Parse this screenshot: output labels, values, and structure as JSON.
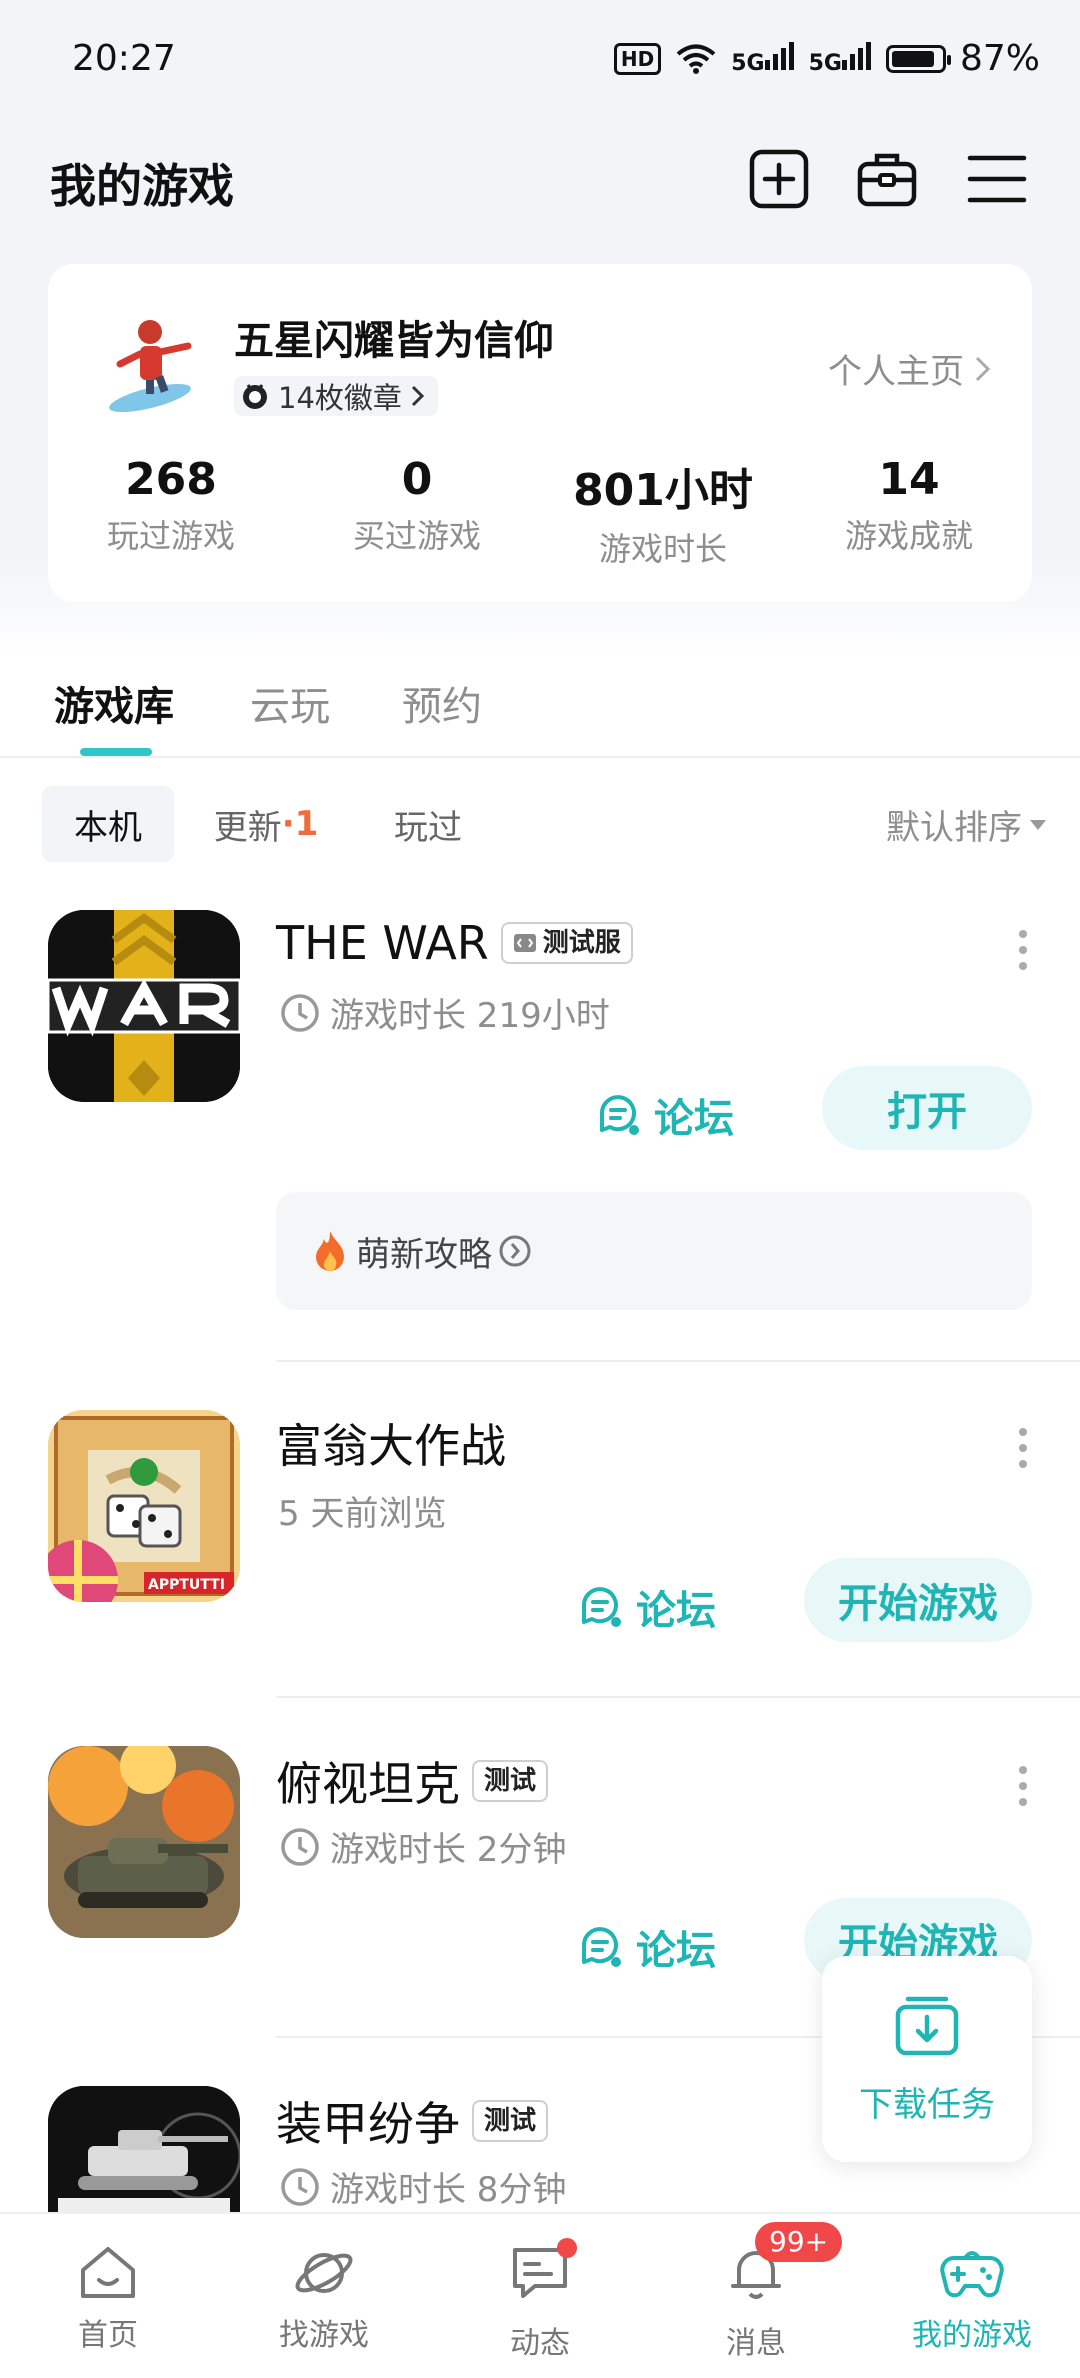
{
  "status_bar": {
    "time": "20:27",
    "hd": "HD",
    "net1": "5G",
    "net2": "5G",
    "battery": "87%",
    "battery_level": 0.87
  },
  "header": {
    "title": "我的游戏",
    "icons": [
      "add-square-icon",
      "toolbox-icon",
      "menu-icon"
    ]
  },
  "profile": {
    "username": "五星闪耀皆为信仰",
    "badges": "14枚徽章",
    "homepage": "个人主页",
    "stats": [
      {
        "value": "268",
        "label": "玩过游戏"
      },
      {
        "value": "0",
        "label": "买过游戏"
      },
      {
        "value": "801小时",
        "label": "游戏时长"
      },
      {
        "value": "14",
        "label": "游戏成就"
      }
    ]
  },
  "tabs": [
    "游戏库",
    "云玩",
    "预约"
  ],
  "filters": {
    "local": "本机",
    "update": "更新",
    "update_sep": "·",
    "update_count": "1",
    "played": "玩过",
    "sort": "默认排序"
  },
  "games": [
    {
      "name": "THE WAR",
      "tag": "测试服",
      "sub": "游戏时长 219小时",
      "forum": "论坛",
      "action": "打开",
      "guide": "萌新攻略"
    },
    {
      "name": "富翁大作战",
      "sub": "5 天前浏览",
      "forum": "论坛",
      "action": "开始游戏"
    },
    {
      "name": "俯视坦克",
      "tag": "测试",
      "sub": "游戏时长 2分钟",
      "forum": "论坛",
      "action": "开始游戏"
    },
    {
      "name": "装甲纷争",
      "tag": "测试",
      "sub": "游戏时长 8分钟"
    }
  ],
  "float": {
    "label": "下载任务"
  },
  "bottom_nav": [
    {
      "label": "首页"
    },
    {
      "label": "找游戏"
    },
    {
      "label": "动态"
    },
    {
      "label": "消息",
      "badge": "99+"
    },
    {
      "label": "我的游戏"
    }
  ],
  "colors": {
    "accent": "#1fb5b5",
    "badge": "#f04848",
    "update_count": "#f06b3a"
  }
}
